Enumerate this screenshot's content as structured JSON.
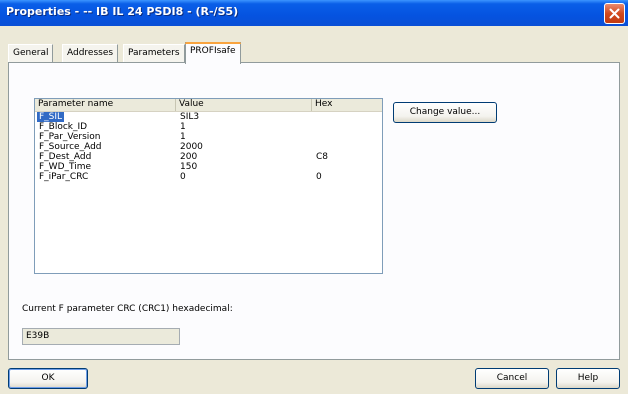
{
  "window": {
    "title": "Properties - -- IB IL 24 PSDI8 - (R-/S5)"
  },
  "tabs": [
    {
      "label": "General"
    },
    {
      "label": "Addresses"
    },
    {
      "label": "Parameters"
    },
    {
      "label": "PROFIsafe"
    }
  ],
  "active_tab": "PROFIsafe",
  "parameters_table": {
    "columns": [
      "Parameter name",
      "Value",
      "Hex"
    ],
    "rows": [
      {
        "name": "F_SIL",
        "value": "SIL3",
        "hex": "",
        "selected": true
      },
      {
        "name": "F_Block_ID",
        "value": "1",
        "hex": ""
      },
      {
        "name": "F_Par_Version",
        "value": "1",
        "hex": ""
      },
      {
        "name": "F_Source_Add",
        "value": "2000",
        "hex": ""
      },
      {
        "name": "F_Dest_Add",
        "value": "200",
        "hex": "C8"
      },
      {
        "name": "F_WD_Time",
        "value": "150",
        "hex": ""
      },
      {
        "name": "F_iPar_CRC",
        "value": "0",
        "hex": "0"
      }
    ]
  },
  "change_value_button": "Change value...",
  "crc": {
    "label": "Current F parameter CRC (CRC1) hexadecimal:",
    "value": "E39B"
  },
  "footer": {
    "ok": "OK",
    "cancel": "Cancel",
    "help": "Help"
  },
  "colors": {
    "titlebar": "#0553E0",
    "selection": "#316AC5",
    "close_button": "#D2491E",
    "tab_highlight": "#F9A43F"
  },
  "icons": {
    "close": "close-icon"
  }
}
